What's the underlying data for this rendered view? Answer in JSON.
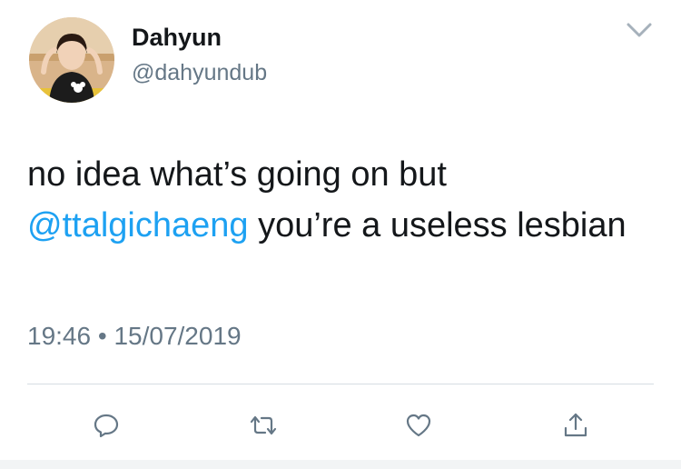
{
  "author": {
    "display_name": "Dahyun",
    "handle": "@dahyundub"
  },
  "tweet": {
    "text_before_mention": "no idea what’s going on but ",
    "mention": "@ttalgichaeng",
    "text_after_mention": " you’re a useless lesbian"
  },
  "meta": {
    "time": "19:46",
    "separator": "•",
    "date": "15/07/2019"
  },
  "icons": {
    "menu": "chevron-down-icon",
    "reply": "reply-icon",
    "retweet": "retweet-icon",
    "like": "like-icon",
    "share": "share-icon"
  },
  "colors": {
    "mention": "#1da1f2",
    "secondary_text": "#657786",
    "icon": "#657786",
    "primary_text": "#14171a"
  }
}
